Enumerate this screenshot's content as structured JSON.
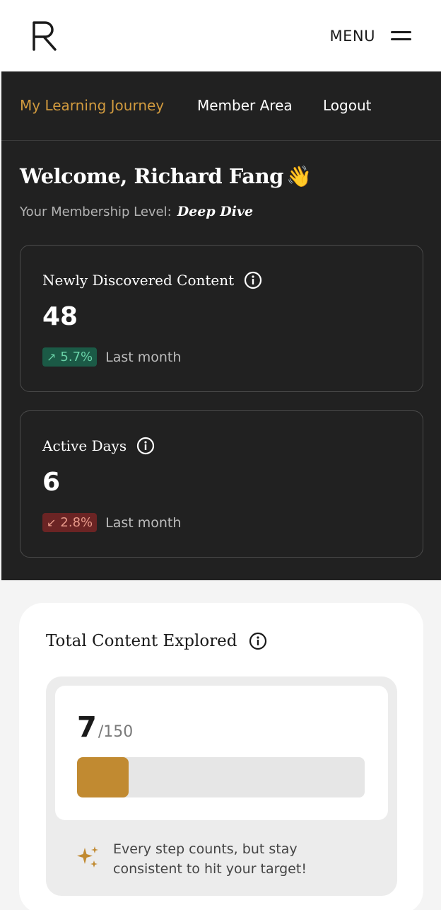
{
  "header": {
    "menu_label": "MENU",
    "logo_icon": "r-logo-icon",
    "menu_icon": "hamburger-icon"
  },
  "nav": {
    "items": [
      "My Learning Journey",
      "Member Area",
      "Logout"
    ],
    "active_index": 0
  },
  "welcome": {
    "title": "Welcome, Richard Fang",
    "emoji": "👋",
    "level_label": "Your Membership Level:",
    "level_value": "Deep Dive"
  },
  "stats": [
    {
      "title": "Newly Discovered Content",
      "value": "48",
      "change": "5.7%",
      "direction": "up",
      "period": "Last month"
    },
    {
      "title": "Active Days",
      "value": "6",
      "change": "2.8%",
      "direction": "down",
      "period": "Last month"
    }
  ],
  "total": {
    "title": "Total Content Explored",
    "current": "7",
    "max_label": "/150",
    "progress_fraction": 0.18,
    "tip": "Every step counts, but stay consistent to hit your target!"
  },
  "colors": {
    "accent": "#c18a31",
    "nav_active": "#d19a3e",
    "dark_bg": "#212121",
    "up_bg": "#1b5a46",
    "down_bg": "#6b2424"
  }
}
